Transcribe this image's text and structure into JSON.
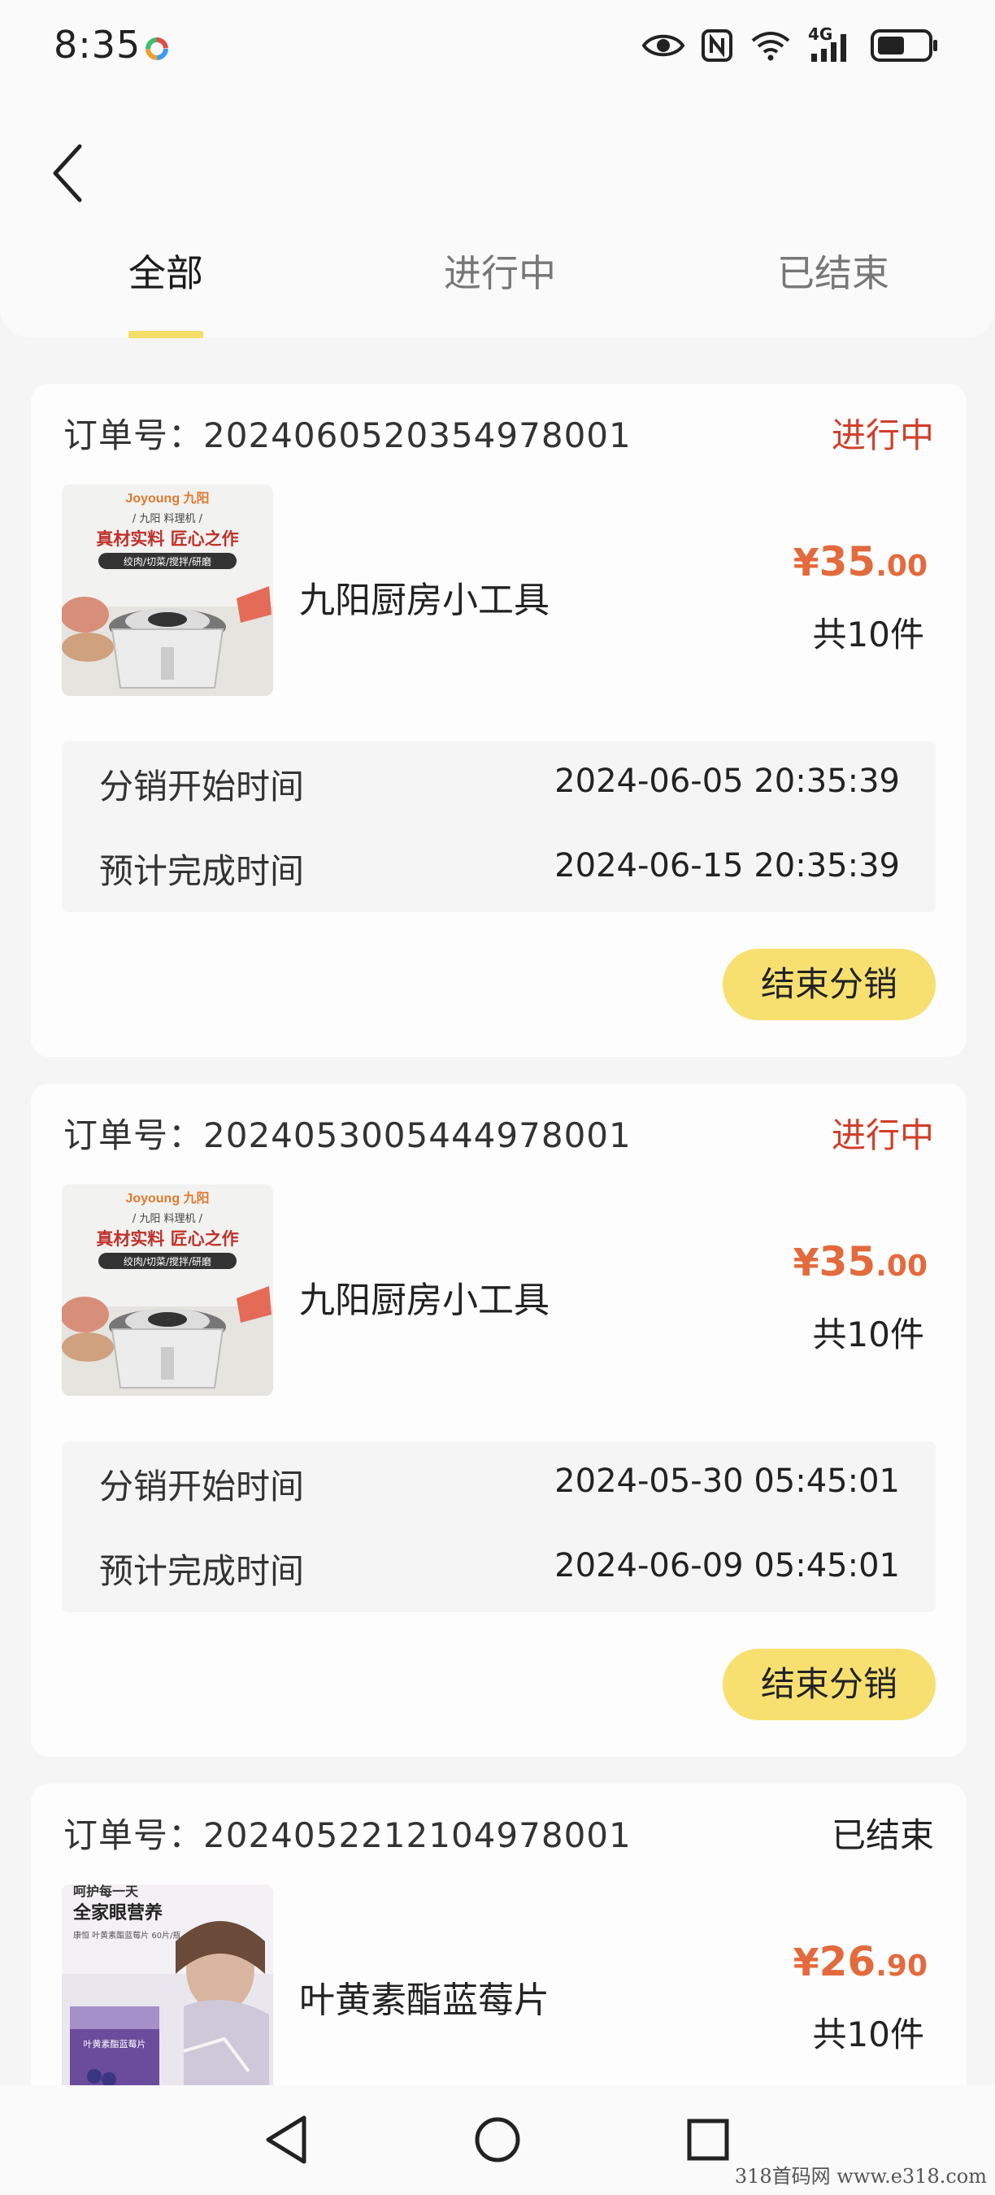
{
  "status_bar": {
    "time": "8:35",
    "icons": [
      "eye-icon",
      "nfc-icon",
      "wifi-icon",
      "signal-4g-icon",
      "battery-icon"
    ],
    "network": "4G"
  },
  "header": {
    "back_icon": "chevron-left-icon",
    "tabs": [
      {
        "label": "全部",
        "active": true
      },
      {
        "label": "进行中",
        "active": false
      },
      {
        "label": "已结束",
        "active": false
      }
    ],
    "accent_color": "#f6dd66"
  },
  "orders": [
    {
      "order_label": "订单号：",
      "order_no": "2024060520354978001",
      "status": "进行中",
      "status_color": "#d23e2a",
      "thumb": {
        "brand": "Joyoung 九阳",
        "line1": "/ 九阳 料理机 /",
        "headline": "真材实料 匠心之作",
        "tags": "绞肉/切菜/搅拌/研磨"
      },
      "product_name": "九阳厨房小工具",
      "price_currency": "¥",
      "price_int": "35",
      "price_dec": ".00",
      "quantity": "共10件",
      "start_label": "分销开始时间",
      "start_time": "2024-06-05 20:35:39",
      "end_label": "预计完成时间",
      "end_time": "2024-06-15 20:35:39",
      "action_label": "结束分销"
    },
    {
      "order_label": "订单号：",
      "order_no": "2024053005444978001",
      "status": "进行中",
      "status_color": "#d23e2a",
      "thumb": {
        "brand": "Joyoung 九阳",
        "line1": "/ 九阳 料理机 /",
        "headline": "真材实料 匠心之作",
        "tags": "绞肉/切菜/搅拌/研磨"
      },
      "product_name": "九阳厨房小工具",
      "price_currency": "¥",
      "price_int": "35",
      "price_dec": ".00",
      "quantity": "共10件",
      "start_label": "分销开始时间",
      "start_time": "2024-05-30 05:45:01",
      "end_label": "预计完成时间",
      "end_time": "2024-06-09 05:45:01",
      "action_label": "结束分销"
    },
    {
      "order_label": "订单号：",
      "order_no": "2024052212104978001",
      "status": "已结束",
      "status_color": "#222222",
      "thumb": {
        "top": "呵护每一天",
        "headline": "全家眼营养",
        "sub": "康恒 叶黄素酯蓝莓片 60片/瓶"
      },
      "product_name": "叶黄素酯蓝莓片",
      "price_currency": "¥",
      "price_int": "26",
      "price_dec": ".90",
      "quantity": "共10件"
    }
  ],
  "nav_bar": {
    "icons": [
      "back-triangle-icon",
      "home-circle-icon",
      "recents-square-icon"
    ]
  },
  "watermark": "318首码网  www.e318.com"
}
